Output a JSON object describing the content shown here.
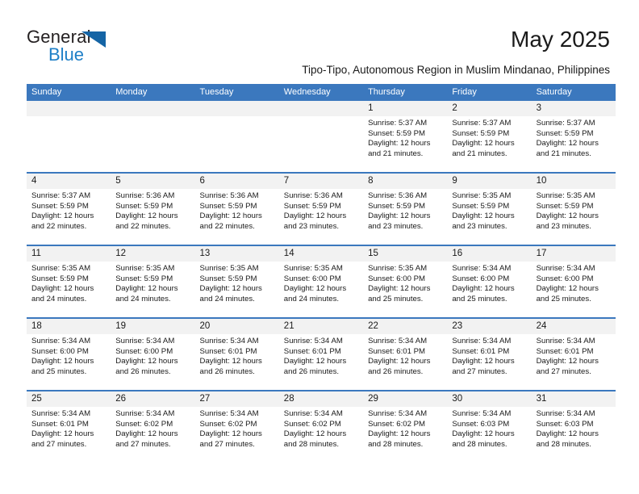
{
  "branding": {
    "logo_text_primary": "General",
    "logo_text_secondary": "Blue",
    "logo_icon": "triangle-icon",
    "accent_color": "#3b78be",
    "logo_blue": "#1e7fc7",
    "header_band_color": "#f2f2f2"
  },
  "header": {
    "title": "May 2025",
    "subtitle": "Tipo-Tipo, Autonomous Region in Muslim Mindanao, Philippines"
  },
  "calendar": {
    "weekdays": [
      "Sunday",
      "Monday",
      "Tuesday",
      "Wednesday",
      "Thursday",
      "Friday",
      "Saturday"
    ],
    "weeks": [
      [
        {
          "day": "",
          "sunrise": "",
          "sunset": "",
          "daylight": ""
        },
        {
          "day": "",
          "sunrise": "",
          "sunset": "",
          "daylight": ""
        },
        {
          "day": "",
          "sunrise": "",
          "sunset": "",
          "daylight": ""
        },
        {
          "day": "",
          "sunrise": "",
          "sunset": "",
          "daylight": ""
        },
        {
          "day": "1",
          "sunrise": "Sunrise: 5:37 AM",
          "sunset": "Sunset: 5:59 PM",
          "daylight": "Daylight: 12 hours and 21 minutes."
        },
        {
          "day": "2",
          "sunrise": "Sunrise: 5:37 AM",
          "sunset": "Sunset: 5:59 PM",
          "daylight": "Daylight: 12 hours and 21 minutes."
        },
        {
          "day": "3",
          "sunrise": "Sunrise: 5:37 AM",
          "sunset": "Sunset: 5:59 PM",
          "daylight": "Daylight: 12 hours and 21 minutes."
        }
      ],
      [
        {
          "day": "4",
          "sunrise": "Sunrise: 5:37 AM",
          "sunset": "Sunset: 5:59 PM",
          "daylight": "Daylight: 12 hours and 22 minutes."
        },
        {
          "day": "5",
          "sunrise": "Sunrise: 5:36 AM",
          "sunset": "Sunset: 5:59 PM",
          "daylight": "Daylight: 12 hours and 22 minutes."
        },
        {
          "day": "6",
          "sunrise": "Sunrise: 5:36 AM",
          "sunset": "Sunset: 5:59 PM",
          "daylight": "Daylight: 12 hours and 22 minutes."
        },
        {
          "day": "7",
          "sunrise": "Sunrise: 5:36 AM",
          "sunset": "Sunset: 5:59 PM",
          "daylight": "Daylight: 12 hours and 23 minutes."
        },
        {
          "day": "8",
          "sunrise": "Sunrise: 5:36 AM",
          "sunset": "Sunset: 5:59 PM",
          "daylight": "Daylight: 12 hours and 23 minutes."
        },
        {
          "day": "9",
          "sunrise": "Sunrise: 5:35 AM",
          "sunset": "Sunset: 5:59 PM",
          "daylight": "Daylight: 12 hours and 23 minutes."
        },
        {
          "day": "10",
          "sunrise": "Sunrise: 5:35 AM",
          "sunset": "Sunset: 5:59 PM",
          "daylight": "Daylight: 12 hours and 23 minutes."
        }
      ],
      [
        {
          "day": "11",
          "sunrise": "Sunrise: 5:35 AM",
          "sunset": "Sunset: 5:59 PM",
          "daylight": "Daylight: 12 hours and 24 minutes."
        },
        {
          "day": "12",
          "sunrise": "Sunrise: 5:35 AM",
          "sunset": "Sunset: 5:59 PM",
          "daylight": "Daylight: 12 hours and 24 minutes."
        },
        {
          "day": "13",
          "sunrise": "Sunrise: 5:35 AM",
          "sunset": "Sunset: 5:59 PM",
          "daylight": "Daylight: 12 hours and 24 minutes."
        },
        {
          "day": "14",
          "sunrise": "Sunrise: 5:35 AM",
          "sunset": "Sunset: 6:00 PM",
          "daylight": "Daylight: 12 hours and 24 minutes."
        },
        {
          "day": "15",
          "sunrise": "Sunrise: 5:35 AM",
          "sunset": "Sunset: 6:00 PM",
          "daylight": "Daylight: 12 hours and 25 minutes."
        },
        {
          "day": "16",
          "sunrise": "Sunrise: 5:34 AM",
          "sunset": "Sunset: 6:00 PM",
          "daylight": "Daylight: 12 hours and 25 minutes."
        },
        {
          "day": "17",
          "sunrise": "Sunrise: 5:34 AM",
          "sunset": "Sunset: 6:00 PM",
          "daylight": "Daylight: 12 hours and 25 minutes."
        }
      ],
      [
        {
          "day": "18",
          "sunrise": "Sunrise: 5:34 AM",
          "sunset": "Sunset: 6:00 PM",
          "daylight": "Daylight: 12 hours and 25 minutes."
        },
        {
          "day": "19",
          "sunrise": "Sunrise: 5:34 AM",
          "sunset": "Sunset: 6:00 PM",
          "daylight": "Daylight: 12 hours and 26 minutes."
        },
        {
          "day": "20",
          "sunrise": "Sunrise: 5:34 AM",
          "sunset": "Sunset: 6:01 PM",
          "daylight": "Daylight: 12 hours and 26 minutes."
        },
        {
          "day": "21",
          "sunrise": "Sunrise: 5:34 AM",
          "sunset": "Sunset: 6:01 PM",
          "daylight": "Daylight: 12 hours and 26 minutes."
        },
        {
          "day": "22",
          "sunrise": "Sunrise: 5:34 AM",
          "sunset": "Sunset: 6:01 PM",
          "daylight": "Daylight: 12 hours and 26 minutes."
        },
        {
          "day": "23",
          "sunrise": "Sunrise: 5:34 AM",
          "sunset": "Sunset: 6:01 PM",
          "daylight": "Daylight: 12 hours and 27 minutes."
        },
        {
          "day": "24",
          "sunrise": "Sunrise: 5:34 AM",
          "sunset": "Sunset: 6:01 PM",
          "daylight": "Daylight: 12 hours and 27 minutes."
        }
      ],
      [
        {
          "day": "25",
          "sunrise": "Sunrise: 5:34 AM",
          "sunset": "Sunset: 6:01 PM",
          "daylight": "Daylight: 12 hours and 27 minutes."
        },
        {
          "day": "26",
          "sunrise": "Sunrise: 5:34 AM",
          "sunset": "Sunset: 6:02 PM",
          "daylight": "Daylight: 12 hours and 27 minutes."
        },
        {
          "day": "27",
          "sunrise": "Sunrise: 5:34 AM",
          "sunset": "Sunset: 6:02 PM",
          "daylight": "Daylight: 12 hours and 27 minutes."
        },
        {
          "day": "28",
          "sunrise": "Sunrise: 5:34 AM",
          "sunset": "Sunset: 6:02 PM",
          "daylight": "Daylight: 12 hours and 28 minutes."
        },
        {
          "day": "29",
          "sunrise": "Sunrise: 5:34 AM",
          "sunset": "Sunset: 6:02 PM",
          "daylight": "Daylight: 12 hours and 28 minutes."
        },
        {
          "day": "30",
          "sunrise": "Sunrise: 5:34 AM",
          "sunset": "Sunset: 6:03 PM",
          "daylight": "Daylight: 12 hours and 28 minutes."
        },
        {
          "day": "31",
          "sunrise": "Sunrise: 5:34 AM",
          "sunset": "Sunset: 6:03 PM",
          "daylight": "Daylight: 12 hours and 28 minutes."
        }
      ]
    ]
  }
}
